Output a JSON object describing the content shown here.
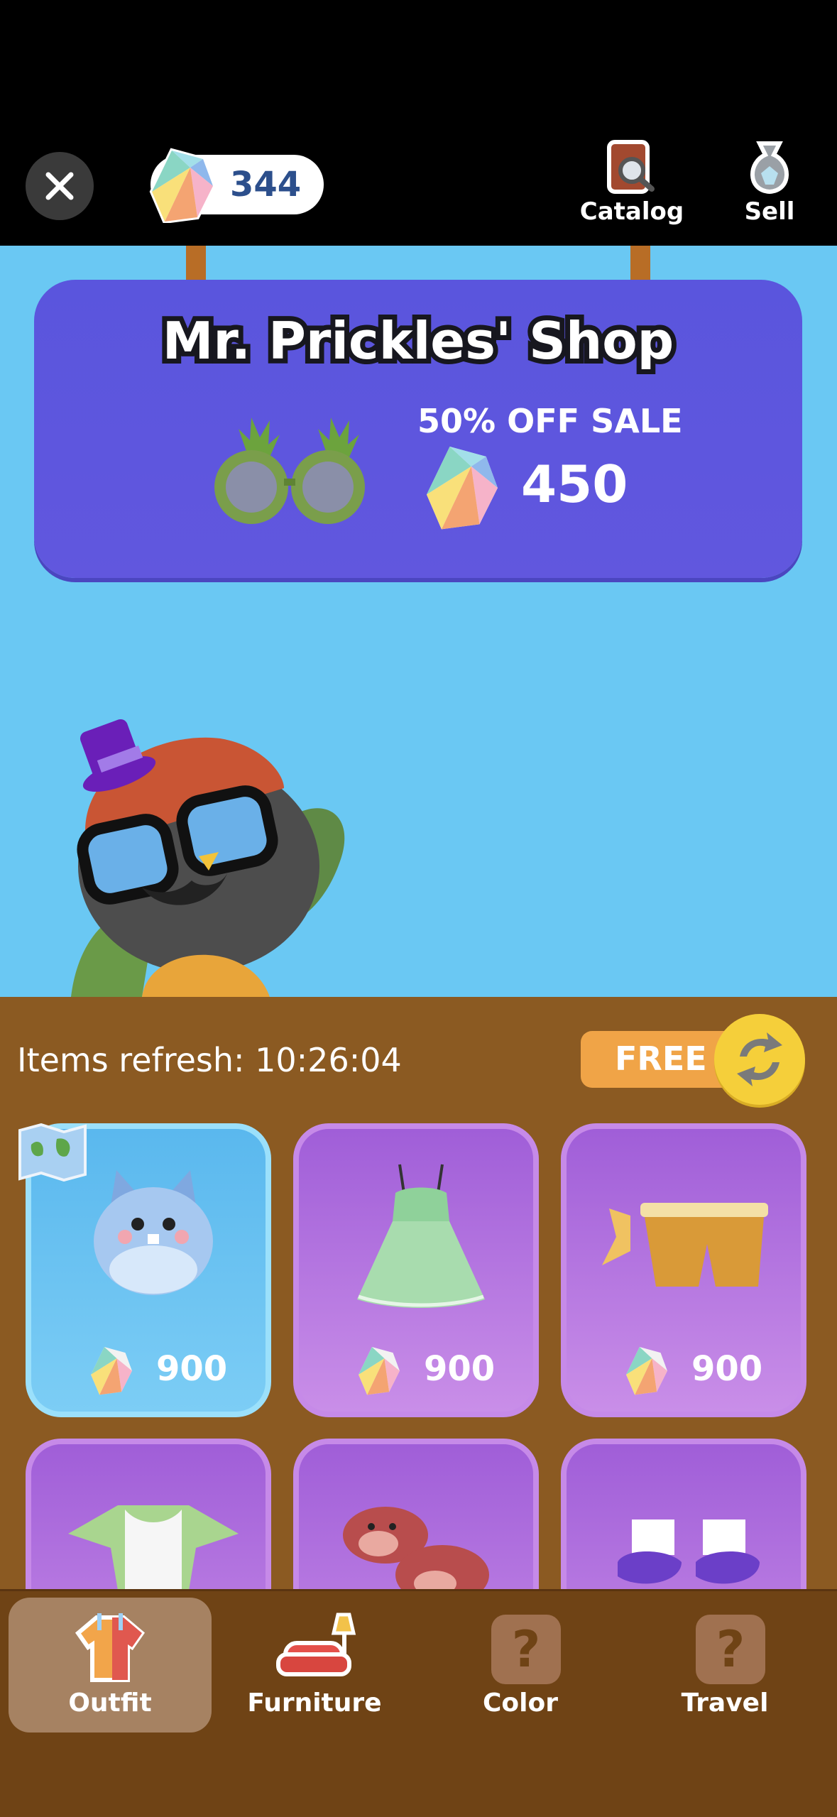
{
  "header": {
    "gem_count": "344",
    "catalog_label": "Catalog",
    "sell_label": "Sell"
  },
  "shop": {
    "title": "Mr. Prickles' Shop",
    "sale_label": "50% OFF SALE",
    "sale_price": "450"
  },
  "items": {
    "refresh_label": "Items refresh: 10:26:04",
    "free_label": "FREE",
    "cards": [
      {
        "name": "bunny-hood",
        "price": "900"
      },
      {
        "name": "green-dress",
        "price": "900"
      },
      {
        "name": "scale-shorts",
        "price": "900"
      },
      {
        "name": "white-shirt",
        "price": ""
      },
      {
        "name": "cow-slippers",
        "price": ""
      },
      {
        "name": "purple-shoes",
        "price": ""
      }
    ]
  },
  "nav": {
    "items": [
      {
        "label": "Outfit",
        "icon": "shirt-icon",
        "active": true
      },
      {
        "label": "Furniture",
        "icon": "sofa-icon"
      },
      {
        "label": "Color",
        "icon": "question-icon"
      },
      {
        "label": "Travel",
        "icon": "question-icon"
      }
    ]
  },
  "colors": {
    "sky": "#6ac8f3",
    "banner": "#5a55dd",
    "wood": "#8b5a22",
    "nav": "#6f4315",
    "gem_text": "#2c4f8c"
  }
}
